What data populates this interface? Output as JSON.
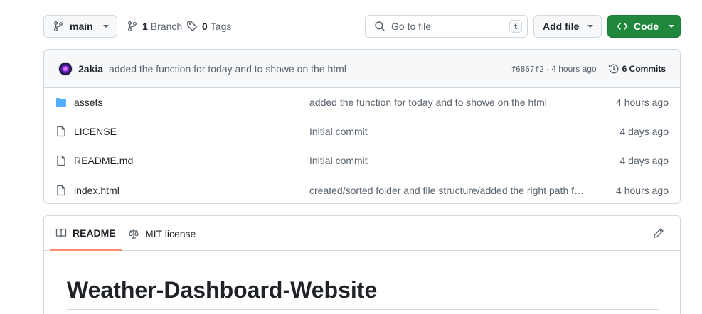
{
  "toolbar": {
    "branch_label": "main",
    "branches_count": "1",
    "branches_label": "Branch",
    "tags_count": "0",
    "tags_label": "Tags",
    "search_placeholder": "Go to file",
    "search_shortcut": "t",
    "add_file_label": "Add file",
    "code_label": "Code"
  },
  "commit": {
    "author": "2akia",
    "message": "added the function for today and to showe on the html",
    "sha": "f6867f2",
    "time": "· 4 hours ago",
    "commits_count_label": "6 Commits"
  },
  "files": [
    {
      "name": "assets",
      "type": "folder",
      "message": "added the function for today and to showe on the html",
      "time": "4 hours ago"
    },
    {
      "name": "LICENSE",
      "type": "file",
      "message": "Initial commit",
      "time": "4 days ago"
    },
    {
      "name": "README.md",
      "type": "file",
      "message": "Initial commit",
      "time": "4 days ago"
    },
    {
      "name": "index.html",
      "type": "file",
      "message": "created/sorted folder and file structure/added the right path for the files",
      "time": "4 hours ago"
    }
  ],
  "readme": {
    "tab_readme": "README",
    "tab_license": "MIT license",
    "heading": "Weather-Dashboard-Website"
  },
  "colors": {
    "code_button": "#1f883d",
    "folder_icon": "#54aeff",
    "active_tab_underline": "#fd8c73"
  }
}
